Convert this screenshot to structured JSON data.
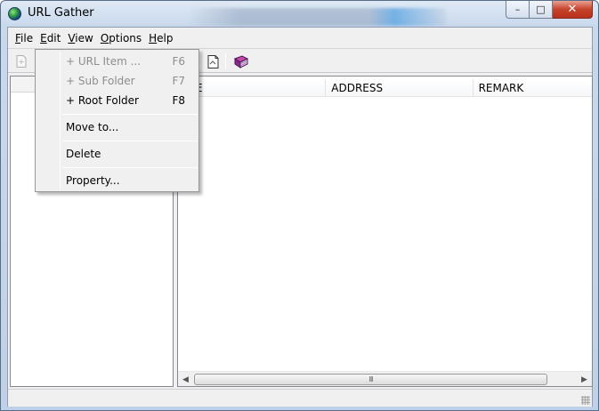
{
  "window": {
    "title": "URL Gather",
    "minimize": "–",
    "maximize": "□",
    "close": "✕"
  },
  "menubar": [
    {
      "label": "File",
      "key": "F",
      "rest": "ile"
    },
    {
      "label": "Edit",
      "key": "E",
      "rest": "dit"
    },
    {
      "label": "View",
      "key": "V",
      "rest": "iew"
    },
    {
      "label": "Options",
      "key": "O",
      "rest": "ptions"
    },
    {
      "label": "Help",
      "key": "H",
      "rest": "elp"
    }
  ],
  "toolbar": {
    "icons": [
      "new-document-icon",
      "page-icon",
      "book-icon"
    ]
  },
  "list": {
    "columns": [
      "TLE",
      "ADDRESS",
      "REMARK"
    ]
  },
  "scrollbar": {
    "left_arrow": "◀",
    "right_arrow": "▶",
    "thumb_grip": "III"
  },
  "edit_menu": {
    "items": [
      {
        "label": "+ URL Item ...",
        "shortcut": "F6",
        "enabled": false
      },
      {
        "label": "+ Sub Folder",
        "shortcut": "F7",
        "enabled": false
      },
      {
        "label": "+ Root Folder",
        "shortcut": "F8",
        "enabled": true
      },
      {
        "label": "Move to...",
        "shortcut": "",
        "enabled": true
      },
      {
        "label": "Delete",
        "shortcut": "",
        "enabled": true
      },
      {
        "label": "Property...",
        "shortcut": "",
        "enabled": true
      }
    ]
  },
  "colors": {
    "titlebar": "#c9d9ec",
    "close_button": "#c7432b",
    "disabled_text": "#8d8d8d"
  }
}
